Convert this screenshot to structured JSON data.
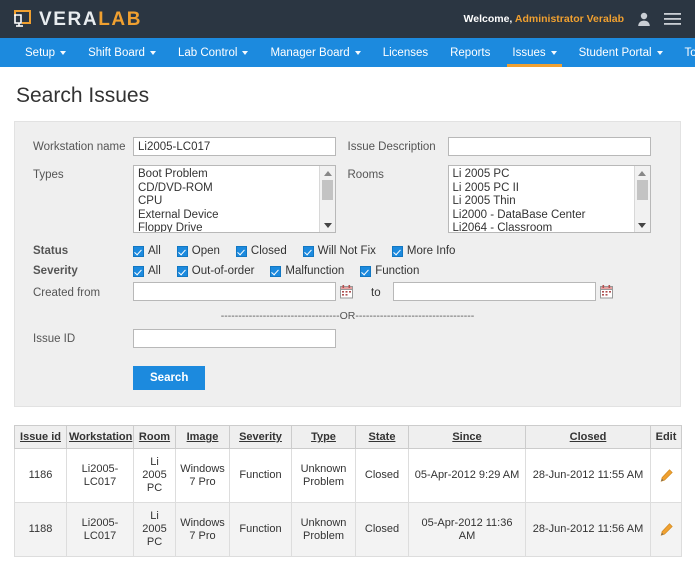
{
  "topbar": {
    "logo_vera": "VERA",
    "logo_lab": "LAB",
    "welcome_prefix": "Welcome,",
    "welcome_user": "Administrator Veralab"
  },
  "nav": {
    "items": [
      {
        "label": "Setup",
        "caret": true,
        "active": false
      },
      {
        "label": "Shift Board",
        "caret": true,
        "active": false
      },
      {
        "label": "Lab Control",
        "caret": true,
        "active": false
      },
      {
        "label": "Manager Board",
        "caret": true,
        "active": false
      },
      {
        "label": "Licenses",
        "caret": false,
        "active": false
      },
      {
        "label": "Reports",
        "caret": false,
        "active": false
      },
      {
        "label": "Issues",
        "caret": true,
        "active": true
      },
      {
        "label": "Student Portal",
        "caret": true,
        "active": false
      },
      {
        "label": "Tools",
        "caret": true,
        "active": false
      }
    ]
  },
  "page": {
    "title": "Search Issues"
  },
  "form": {
    "workstation_label": "Workstation name",
    "workstation_value": "Li2005-LC017",
    "workstation_placeholder": "",
    "description_label": "Issue Description",
    "description_value": "",
    "description_placeholder": "",
    "types_label": "Types",
    "types_options": [
      "Boot Problem",
      "CD/DVD-ROM",
      "CPU",
      "External Device",
      "Floppy Drive"
    ],
    "rooms_label": "Rooms",
    "rooms_options": [
      "Li 2005 PC",
      "Li 2005 PC II",
      "Li 2005 Thin",
      "Li2000 - DataBase Center",
      "Li2064 - Classroom"
    ],
    "status_label": "Status",
    "status_options": [
      "All",
      "Open",
      "Closed",
      "Will Not Fix",
      "More Info"
    ],
    "severity_label": "Severity",
    "severity_options": [
      "All",
      "Out-of-order",
      "Malfunction",
      "Function"
    ],
    "created_from_label": "Created from",
    "created_from_value": "",
    "to_label": "to",
    "created_to_value": "",
    "or_separator": "----------------------------------OR----------------------------------",
    "issue_id_label": "Issue ID",
    "issue_id_value": "",
    "search_button": "Search"
  },
  "results": {
    "columns": [
      {
        "label": "Issue id",
        "sortable": true
      },
      {
        "label": "Workstation",
        "sortable": true
      },
      {
        "label": "Room",
        "sortable": true
      },
      {
        "label": "Image",
        "sortable": true
      },
      {
        "label": "Severity",
        "sortable": true
      },
      {
        "label": "Type",
        "sortable": true
      },
      {
        "label": "State",
        "sortable": true
      },
      {
        "label": "Since",
        "sortable": true
      },
      {
        "label": "Closed",
        "sortable": true
      },
      {
        "label": "Edit",
        "sortable": false
      }
    ],
    "rows": [
      {
        "issue_id": "1186",
        "workstation": "Li2005-LC017",
        "room": "Li 2005 PC",
        "image": "Windows 7 Pro",
        "severity": "Function",
        "type": "Unknown Problem",
        "state": "Closed",
        "since": "05-Apr-2012 9:29 AM",
        "closed": "28-Jun-2012 11:55 AM"
      },
      {
        "issue_id": "1188",
        "workstation": "Li2005-LC017",
        "room": "Li 2005 PC",
        "image": "Windows 7 Pro",
        "severity": "Function",
        "type": "Unknown Problem",
        "state": "Closed",
        "since": "05-Apr-2012 11:36 AM",
        "closed": "28-Jun-2012 11:56 AM"
      }
    ]
  },
  "colors": {
    "header_bg": "#2b3642",
    "nav_bg": "#1c8ade",
    "accent_orange": "#f0a030",
    "panel_bg": "#efefef"
  },
  "icons": {
    "user": "user-icon",
    "menu": "hamburger-menu-icon",
    "calendar": "calendar-icon",
    "edit": "pencil-icon"
  }
}
